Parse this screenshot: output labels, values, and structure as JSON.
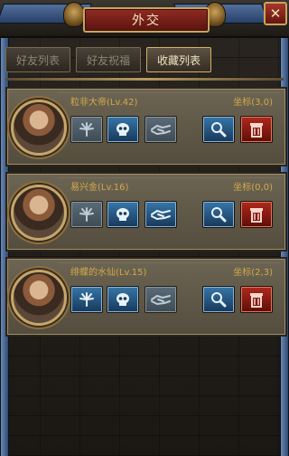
{
  "header": {
    "title": "外交",
    "close_icon": "close-icon"
  },
  "tabs": [
    {
      "label": "好友列表",
      "active": false
    },
    {
      "label": "好友祝福",
      "active": false
    },
    {
      "label": "收藏列表",
      "active": true
    }
  ],
  "players": [
    {
      "name": "粒非大帝(Lv.42)",
      "coords": "坐标(3,0)",
      "actions": [
        "flower-icon",
        "skull-icon",
        "handshake-icon"
      ],
      "enabled": [
        false,
        true,
        false
      ]
    },
    {
      "name": "易兴金(Lv.16)",
      "coords": "坐标(0,0)",
      "actions": [
        "flower-icon",
        "skull-icon",
        "handshake-icon"
      ],
      "enabled": [
        false,
        true,
        true
      ]
    },
    {
      "name": "绯蝶的水仙(Lv.15)",
      "coords": "坐标(2,3)",
      "actions": [
        "flower-icon",
        "skull-icon",
        "handshake-icon"
      ],
      "enabled": [
        true,
        true,
        false
      ]
    }
  ],
  "colors": {
    "accent_gold": "#d2a94c",
    "title_red": "#8f2b22",
    "button_blue": "#3776a8",
    "button_red": "#b0281c"
  }
}
